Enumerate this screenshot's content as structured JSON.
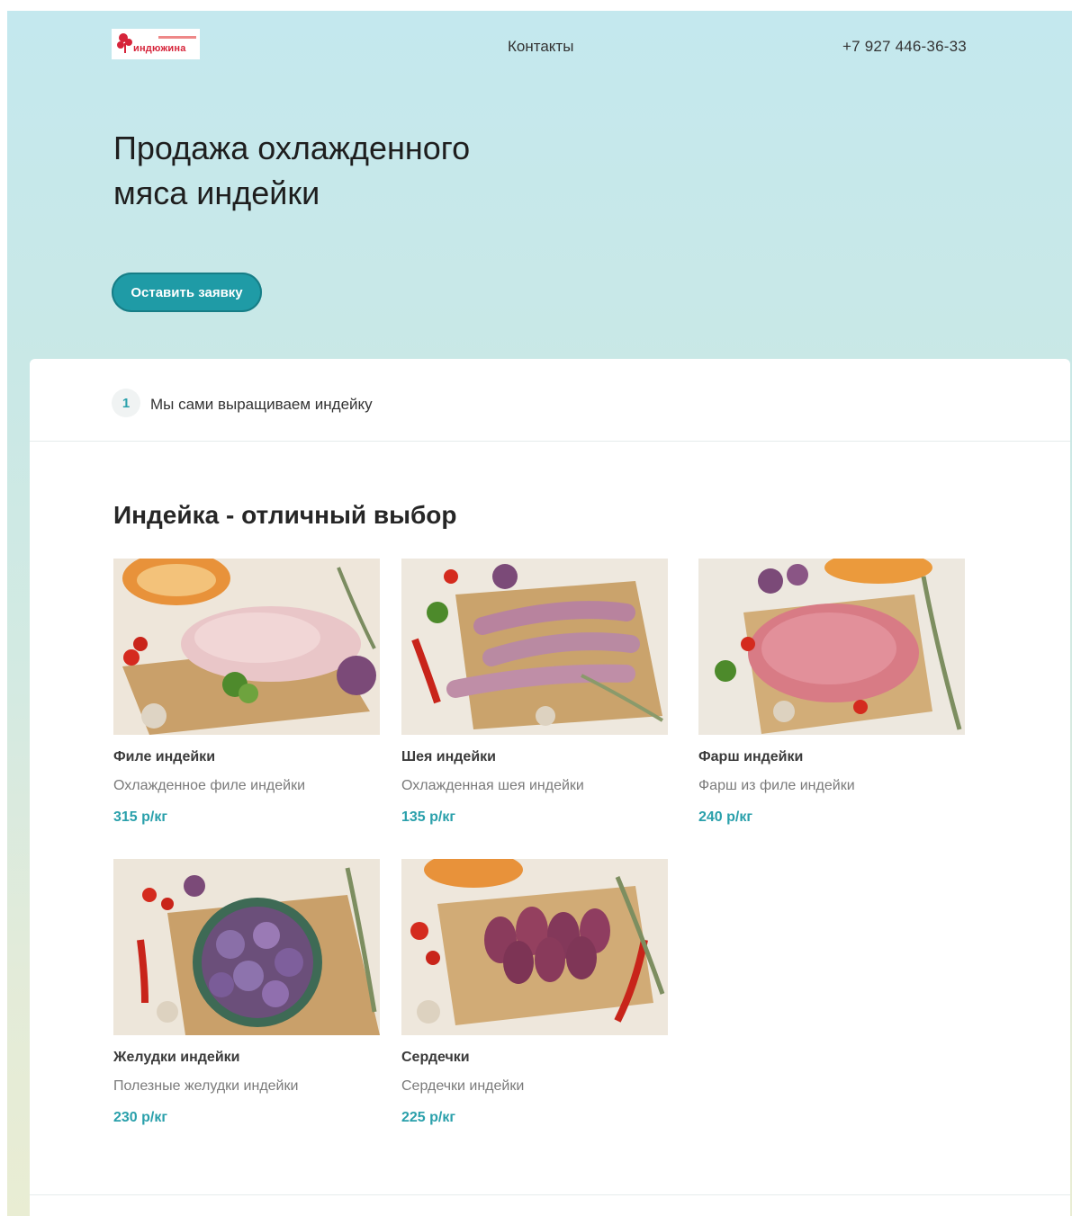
{
  "header": {
    "logo_text": "индюжина",
    "nav_contacts": "Контакты",
    "phone": "+7 927 446-36-33"
  },
  "hero": {
    "title_line1": "Продажа охлажденного",
    "title_line2": "мяса индейки",
    "cta_label": "Оставить заявку"
  },
  "steps": [
    {
      "number": "1",
      "text": "Мы сами выращиваем индейку"
    }
  ],
  "catalog": {
    "title": "Индейка - отличный выбор",
    "products": [
      {
        "name": "Филе индейки",
        "description": "Охлажденное филе индейки",
        "price": "315 р/кг",
        "image": "fillet"
      },
      {
        "name": "Шея индейки",
        "description": "Охлажденная шея индейки",
        "price": "135 р/кг",
        "image": "neck"
      },
      {
        "name": "Фарш индейки",
        "description": "Фарш из филе индейки",
        "price": "240 р/кг",
        "image": "mince"
      },
      {
        "name": "Желудки индейки",
        "description": "Полезные желудки индейки",
        "price": "230 р/кг",
        "image": "gizzards"
      },
      {
        "name": "Сердечки",
        "description": "Сердечки индейки",
        "price": "225 р/кг",
        "image": "hearts"
      }
    ]
  },
  "colors": {
    "accent": "#1f9ba6",
    "price": "#2aa0ab",
    "logo_red": "#d6243a"
  }
}
